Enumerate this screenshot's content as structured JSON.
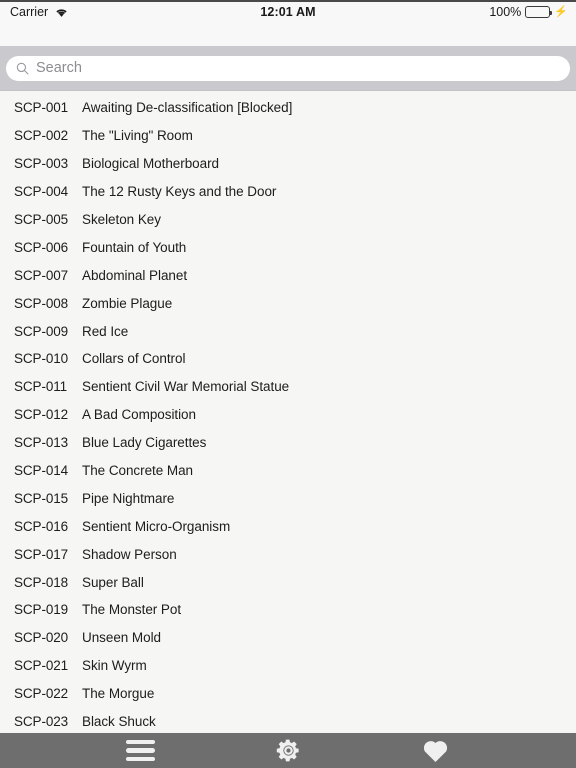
{
  "status_bar": {
    "carrier": "Carrier",
    "wifi_icon": "wifi-icon",
    "time": "12:01 AM",
    "battery_percent": "100%",
    "battery_icon": "battery-full-icon",
    "charging_icon": "lightning-bolt-icon"
  },
  "search": {
    "placeholder": "Search",
    "value": "",
    "icon": "search-icon"
  },
  "list": {
    "rows": [
      {
        "code": "SCP-001",
        "title": "Awaiting De-classification [Blocked]"
      },
      {
        "code": "SCP-002",
        "title": "The \"Living\" Room"
      },
      {
        "code": "SCP-003",
        "title": "Biological Motherboard"
      },
      {
        "code": "SCP-004",
        "title": "The 12 Rusty Keys and the Door"
      },
      {
        "code": "SCP-005",
        "title": "Skeleton Key"
      },
      {
        "code": "SCP-006",
        "title": "Fountain of Youth"
      },
      {
        "code": "SCP-007",
        "title": "Abdominal Planet"
      },
      {
        "code": "SCP-008",
        "title": "Zombie Plague"
      },
      {
        "code": "SCP-009",
        "title": "Red Ice"
      },
      {
        "code": "SCP-010",
        "title": "Collars of Control"
      },
      {
        "code": "SCP-011",
        "title": "Sentient Civil War Memorial Statue"
      },
      {
        "code": "SCP-012",
        "title": "A Bad Composition"
      },
      {
        "code": "SCP-013",
        "title": "Blue Lady Cigarettes"
      },
      {
        "code": "SCP-014",
        "title": "The Concrete Man"
      },
      {
        "code": "SCP-015",
        "title": "Pipe Nightmare"
      },
      {
        "code": "SCP-016",
        "title": "Sentient Micro-Organism"
      },
      {
        "code": "SCP-017",
        "title": "Shadow Person"
      },
      {
        "code": "SCP-018",
        "title": "Super Ball"
      },
      {
        "code": "SCP-019",
        "title": "The Monster Pot"
      },
      {
        "code": "SCP-020",
        "title": "Unseen Mold"
      },
      {
        "code": "SCP-021",
        "title": "Skin Wyrm"
      },
      {
        "code": "SCP-022",
        "title": "The Morgue"
      },
      {
        "code": "SCP-023",
        "title": "Black Shuck"
      }
    ]
  },
  "tab_bar": {
    "items": [
      {
        "icon": "hamburger-menu-icon",
        "label": ""
      },
      {
        "icon": "gear-icon",
        "label": ""
      },
      {
        "icon": "heart-icon",
        "label": ""
      }
    ]
  },
  "colors": {
    "tab_bar_background": "#6e6e6e",
    "search_bar_background": "#c9c9ce",
    "page_background": "#f6f6f5",
    "text": "#1d1d1d",
    "battery_green": "#4cd763"
  }
}
